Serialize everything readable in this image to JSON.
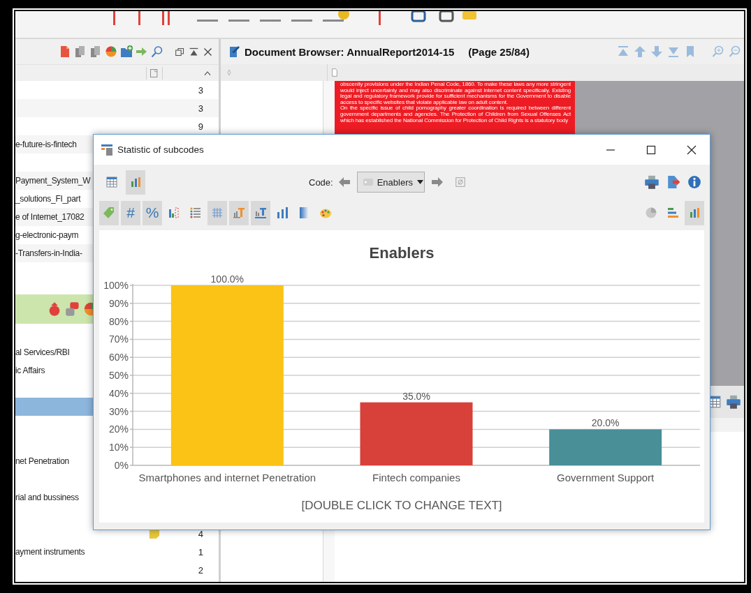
{
  "document_list": {
    "rows": [
      {
        "kind": "document",
        "count": "3"
      },
      {
        "kind": "document",
        "count": "3"
      },
      {
        "kind": "document",
        "count": "9"
      },
      {
        "kind": "document",
        "name": "e-future-is-fintech"
      },
      {
        "kind": "spacer"
      },
      {
        "kind": "document",
        "name": "Payment_System_W"
      },
      {
        "kind": "document",
        "name": "_solutions_FI_part"
      },
      {
        "kind": "document",
        "name": "e of Internet_17082"
      },
      {
        "kind": "document",
        "name": "g-electronic-paym"
      },
      {
        "kind": "document",
        "name": "-Transfers-in-India-"
      },
      {
        "kind": "spacer"
      }
    ]
  },
  "code_list": {
    "rows": [
      {
        "name": "al Services/RBI",
        "selected": false,
        "memo": false
      },
      {
        "name": "ic Affairs",
        "selected": false,
        "memo": false
      },
      {
        "selected": false,
        "memo": false
      },
      {
        "selected": true,
        "memo": false
      },
      {
        "selected": false,
        "memo": false
      },
      {
        "selected": false,
        "memo": false
      },
      {
        "name": "net Penetration",
        "selected": false,
        "memo": false
      },
      {
        "selected": false,
        "memo": false
      },
      {
        "name": "rial and bussiness",
        "selected": false,
        "memo": false
      },
      {
        "selected": false,
        "memo": false
      },
      {
        "count": "4",
        "selected": false,
        "memo": true
      },
      {
        "name": "ayment instruments",
        "count": "1",
        "selected": false,
        "memo": false
      },
      {
        "count": "2",
        "selected": false,
        "memo": false
      }
    ]
  },
  "document_browser": {
    "title": "Document Browser: AnnualReport2014-15",
    "page": "(Page 25/84)",
    "page_text": [
      "obscenity provisions under the Indian Penal Code, 1860. To make these laws any more stringent would inject uncertainty and may also discriminate against internet content specifically. Existing legal and regulatory framework provide for sufficient mechanisms for the Government to disable access to specific websites that violate applicable law on adult content.",
      "On the specific issue of child pornography greater coordination is required between different government departments and agencies. The Protection of Children from Sexual Offenses Act which has established the National Commission for Protection of Child Rights is a statutory body"
    ]
  },
  "dialog": {
    "title": "Statistic of subcodes",
    "view_buttons": [
      {
        "kind": "table",
        "pressed": false
      },
      {
        "kind": "barchart",
        "pressed": true
      }
    ],
    "code_label": "Code:",
    "code_value": "Enablers",
    "format_buttons": [
      {
        "kind": "tag",
        "pressed": true
      },
      {
        "kind": "glyph",
        "label": "#",
        "pressed": true
      },
      {
        "kind": "glyph",
        "label": "%",
        "pressed": true
      },
      {
        "kind": "bardots",
        "pressed": false
      },
      {
        "kind": "list",
        "pressed": false
      },
      {
        "kind": "grid",
        "pressed": true
      },
      {
        "kind": "title-top",
        "pressed": true
      },
      {
        "kind": "title-bottom",
        "pressed": true
      },
      {
        "kind": "bars",
        "pressed": false
      },
      {
        "kind": "gradient",
        "pressed": false
      },
      {
        "kind": "palette",
        "pressed": false
      }
    ],
    "chart_type_buttons": [
      {
        "kind": "pie",
        "pressed": false
      },
      {
        "kind": "hbars",
        "pressed": false
      },
      {
        "kind": "barchart",
        "pressed": true
      }
    ],
    "chart_data": {
      "type": "bar",
      "title": "Enablers",
      "xlabel": "[DOUBLE CLICK TO CHANGE TEXT]",
      "categories": [
        "Smartphones and internet Penetration",
        "Fintech companies",
        "Government Support"
      ],
      "values": [
        100,
        35,
        20
      ],
      "colors": [
        "#fbc316",
        "#d8403a",
        "#488f98"
      ],
      "grid": true,
      "ylim": [
        0,
        100
      ],
      "yticks": [
        {
          "value": 0,
          "label": "0%"
        },
        {
          "value": 10,
          "label": "10%"
        },
        {
          "value": 20,
          "label": "20%"
        },
        {
          "value": 30,
          "label": "30%"
        },
        {
          "value": 40,
          "label": "40%"
        },
        {
          "value": 50,
          "label": "50%"
        },
        {
          "value": 60,
          "label": "60%"
        },
        {
          "value": 70,
          "label": "70%"
        },
        {
          "value": 80,
          "label": "80%"
        },
        {
          "value": 90,
          "label": "90%"
        },
        {
          "value": 100,
          "label": "100%"
        }
      ],
      "value_labels": [
        "100.0%",
        "35.0%",
        "20.0%"
      ]
    }
  }
}
